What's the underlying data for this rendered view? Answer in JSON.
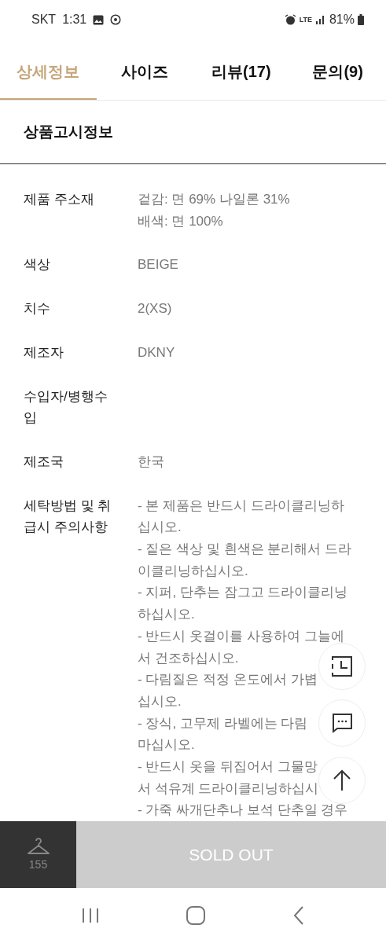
{
  "status_bar": {
    "carrier": "SKT",
    "time": "1:31",
    "network": "LTE",
    "battery": "81%"
  },
  "tabs": [
    {
      "label": "상세정보",
      "selected": true
    },
    {
      "label": "사이즈",
      "selected": false
    },
    {
      "label": "리뷰(17)",
      "selected": false
    },
    {
      "label": "문의(9)",
      "selected": false
    }
  ],
  "section_title": "상품고시정보",
  "rows": [
    {
      "label_lines": [
        "제품 주소재"
      ],
      "value_lines": [
        "겉감: 면 69% 나일론 31%",
        "배색: 면 100%"
      ]
    },
    {
      "label_lines": [
        "색상"
      ],
      "value_lines": [
        "BEIGE"
      ]
    },
    {
      "label_lines": [
        "치수"
      ],
      "value_lines": [
        "2(XS)"
      ]
    },
    {
      "label_lines": [
        "제조자"
      ],
      "value_lines": [
        "DKNY"
      ]
    },
    {
      "label_lines": [
        "수입자/병행수",
        "입"
      ]
    },
    {
      "label_lines": [
        "제조국"
      ],
      "value_lines": [
        "한국"
      ]
    },
    {
      "label_lines": [
        "세탁방법 및 취",
        "급시 주의사항"
      ],
      "value_lines": [
        "- 본 제품은 반드시 드라이클리닝하",
        "십시오.",
        "- 짙은 색상 및 흰색은 분리해서 드라",
        "이클리닝하십시오.",
        "- 지퍼, 단추는 잠그고 드라이클리닝",
        "하십시오.",
        "- 반드시 옷걸이를 사용하여 그늘에",
        "서 건조하십시오.",
        "- 다림질은 적정 온도에서 가볍",
        "십시오.",
        "- 장식, 고무제 라벨에는 다림",
        "마십시오.",
        "- 반드시 옷을 뒤집어서 그물망",
        "서 석유계 드라이클리닝하십시",
        "- 가죽 싸개단추나 보석 단추일 경우"
      ]
    }
  ],
  "wish_count": "155",
  "buy_button": {
    "label": "SOLD OUT",
    "disabled": true
  }
}
